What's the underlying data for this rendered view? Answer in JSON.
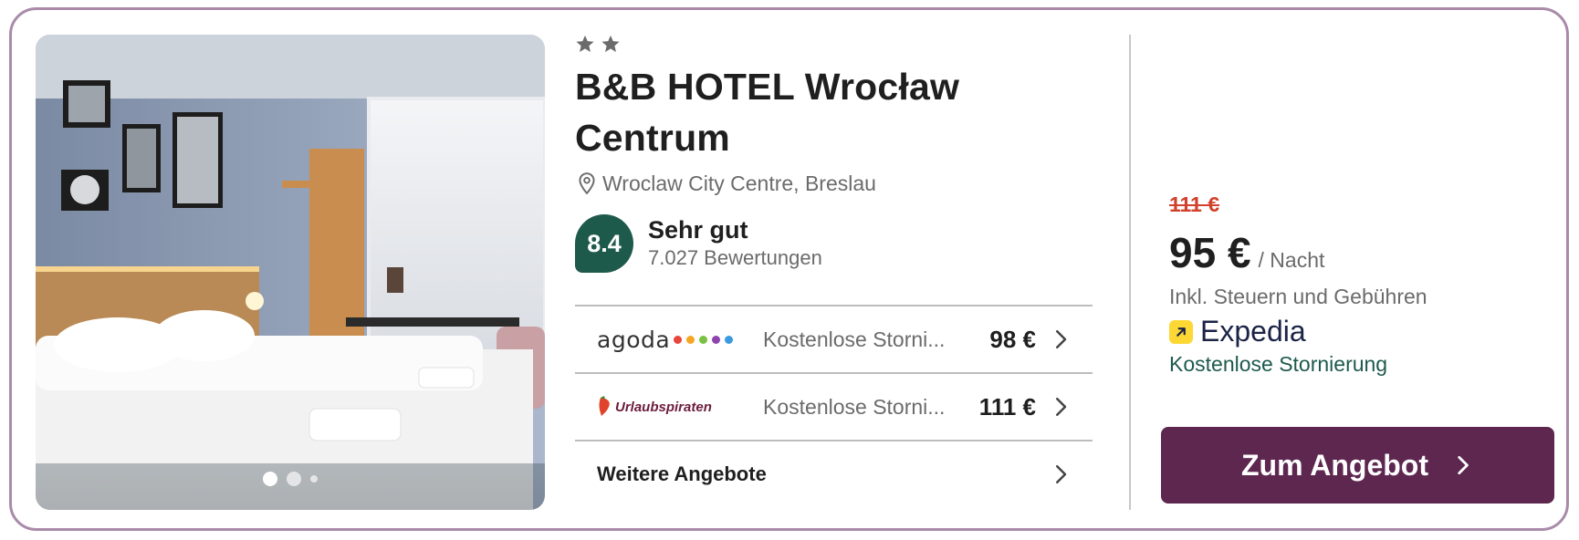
{
  "hotel": {
    "stars": 2,
    "name": "B&B HOTEL Wrocław Centrum",
    "location": "Wroclaw City Centre, Breslau",
    "rating": {
      "score": "8.4",
      "label": "Sehr gut",
      "reviews": "7.027 Bewertungen"
    }
  },
  "offers": [
    {
      "provider": "agoda",
      "description": "Kostenlose Storni...",
      "price": "98 €"
    },
    {
      "provider": "Urlaubspiraten",
      "description": "Kostenlose Storni...",
      "price": "111 €"
    }
  ],
  "more_offers_label": "Weitere Angebote",
  "best_offer": {
    "old_price": "111 €",
    "price": "95 €",
    "unit": "/ Nacht",
    "tax_note": "Inkl. Steuern und Gebühren",
    "provider": "Expedia",
    "cancellation": "Kostenlose Stornierung",
    "cta_label": "Zum Angebot"
  },
  "carousel": {
    "total_dots": 3,
    "active_index": 0
  },
  "colors": {
    "card_border": "#a98ba9",
    "rating_badge": "#1e5a4c",
    "old_price": "#d2412c",
    "cta_bg": "#5e2750",
    "free_cancel": "#1e5a4c",
    "expedia_yellow": "#fdd835"
  },
  "icons": {
    "star": "star-icon",
    "location": "map-pin-icon",
    "chevron": "chevron-right-icon",
    "expedia": "expedia-arrow-icon"
  }
}
